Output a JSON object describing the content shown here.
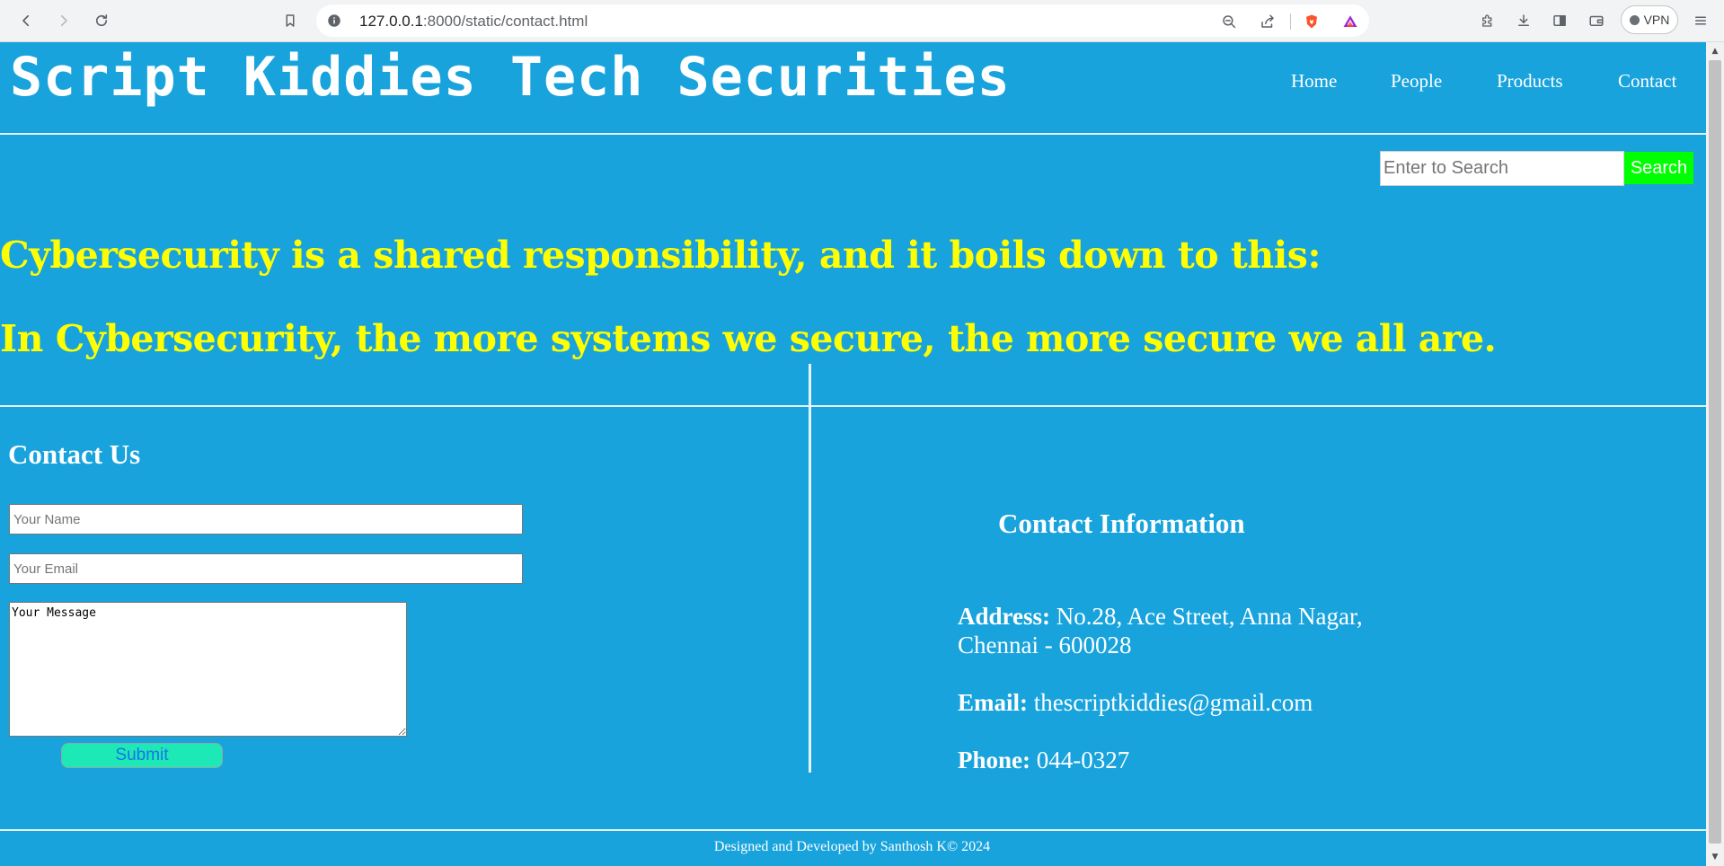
{
  "browser": {
    "url_host": "127.0.0.1",
    "url_rest": ":8000/static/contact.html",
    "vpn_label": "VPN"
  },
  "site": {
    "title": "Script Kiddies Tech Securities",
    "nav": [
      "Home",
      "People",
      "Products",
      "Contact"
    ]
  },
  "search": {
    "placeholder": "Enter to Search",
    "button": "Search"
  },
  "hero": {
    "line1": "Cybersecurity is a shared responsibility, and it boils down to this:",
    "line2": "In Cybersecurity, the more systems we secure, the more secure we all are."
  },
  "contact_form": {
    "title": "Contact Us",
    "name_placeholder": "Your Name",
    "email_placeholder": "Your Email",
    "message_placeholder": "Your Message",
    "submit": "Submit"
  },
  "contact_info": {
    "title": "Contact Information",
    "address_label": "Address:",
    "address_line1": "No.28, Ace Street, Anna Nagar,",
    "address_line2": "Chennai - 600028",
    "email_label": "Email:",
    "email": "thescriptkiddies@gmail.com",
    "phone_label": "Phone:",
    "phone": "044-0327"
  },
  "footer": {
    "text": "Designed and Developed by Santhosh K© 2024"
  },
  "colors": {
    "page_bg": "#18a3dd",
    "hero_text": "#ffff00",
    "search_button": "#00ff00",
    "submit_button": "#1de9b6"
  },
  "icons": [
    "back-icon",
    "forward-icon",
    "reload-icon",
    "bookmark-icon",
    "info-icon",
    "zoom-icon",
    "share-icon",
    "brave-shield-icon",
    "brave-rewards-icon",
    "extensions-icon",
    "download-icon",
    "sidebar-icon",
    "wallet-icon",
    "menu-icon"
  ]
}
